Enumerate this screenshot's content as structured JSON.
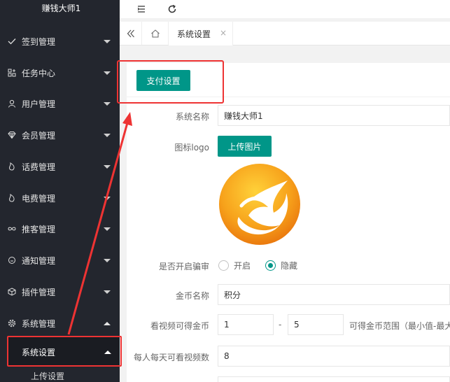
{
  "sidebar": {
    "brand": "赚钱大师1",
    "items": [
      {
        "label": "签到管理",
        "icon": "check-icon"
      },
      {
        "label": "任务中心",
        "icon": "task-icon"
      },
      {
        "label": "用户管理",
        "icon": "user-icon"
      },
      {
        "label": "会员管理",
        "icon": "diamond-icon"
      },
      {
        "label": "话费管理",
        "icon": "fire-icon"
      },
      {
        "label": "电费管理",
        "icon": "fire-icon"
      },
      {
        "label": "推客管理",
        "icon": "infinity-icon"
      },
      {
        "label": "通知管理",
        "icon": "bubble-icon"
      },
      {
        "label": "插件管理",
        "icon": "cube-icon"
      },
      {
        "label": "系统管理",
        "icon": "gear-icon"
      }
    ],
    "active_sub": "系统设置",
    "sub_next": "上传设置"
  },
  "topbar": {
    "icons": [
      "menu-icon",
      "refresh-icon"
    ]
  },
  "tabs": {
    "active": "系统设置",
    "close": "×"
  },
  "toolbar": {
    "pay_settings": "支付设置"
  },
  "form": {
    "system_name_label": "系统名称",
    "system_name_value": "赚钱大师1",
    "logo_label": "图标logo",
    "upload_button": "上传图片",
    "cheat_label": "是否开启骗审",
    "cheat_options": [
      "开启",
      "隐藏"
    ],
    "cheat_selected": "隐藏",
    "coin_name_label": "金币名称",
    "coin_name_value": "积分",
    "video_coin_label": "看视频可得金币",
    "video_coin_min": "1",
    "video_coin_sep": "-",
    "video_coin_max": "5",
    "video_coin_hint": "可得金币范围（最小值-最大",
    "daily_video_label": "每人每天可看视频数",
    "daily_video_value": "8"
  },
  "colors": {
    "primary": "#009688",
    "sidebar_bg": "#23262e",
    "annotation": "#ee3333",
    "logo_orange": "#f39c12"
  }
}
